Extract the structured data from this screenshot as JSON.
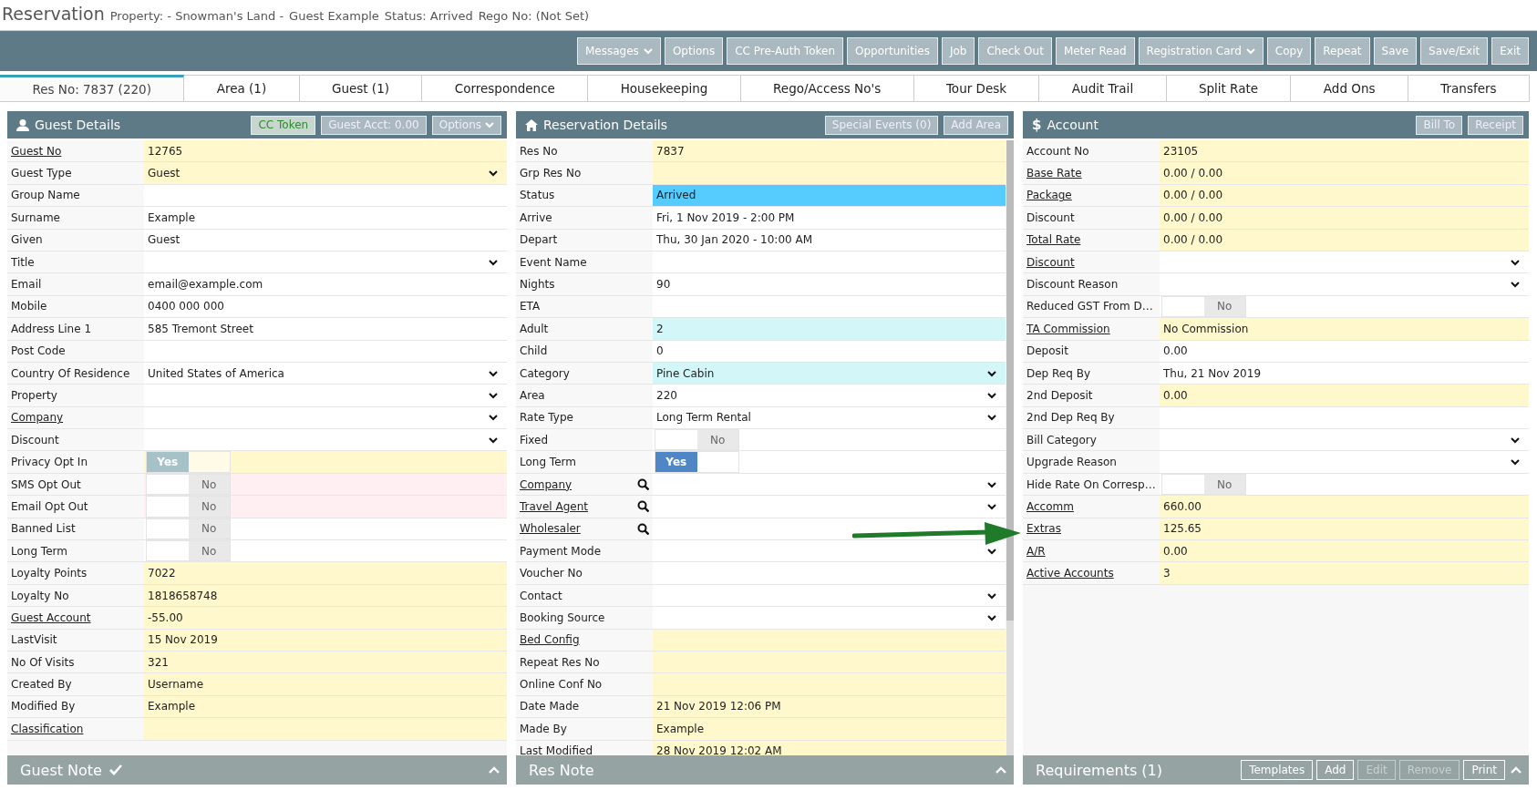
{
  "header": {
    "title": "Reservation",
    "details": [
      "Property: - Snowman's Land -",
      "Guest Example",
      "Status: Arrived",
      "Rego No: (Not Set)"
    ]
  },
  "toolbar": [
    {
      "label": "Messages",
      "dropdown": true
    },
    {
      "label": "Options",
      "dropdown": false
    },
    {
      "label": "CC Pre-Auth Token",
      "dropdown": false
    },
    {
      "label": "Opportunities",
      "dropdown": false
    },
    {
      "label": "Job",
      "dropdown": false
    },
    {
      "label": "Check Out",
      "dropdown": false
    },
    {
      "label": "Meter Read",
      "dropdown": false
    },
    {
      "label": "Registration Card",
      "dropdown": true
    },
    {
      "label": "Copy",
      "dropdown": false
    },
    {
      "label": "Repeat",
      "dropdown": false
    },
    {
      "label": "Save",
      "dropdown": false
    },
    {
      "label": "Save/Exit",
      "dropdown": false
    },
    {
      "label": "Exit",
      "dropdown": false
    }
  ],
  "tabs": [
    {
      "label": "Res No: 7837 (220)",
      "selected": true
    },
    {
      "label": "Area (1)",
      "selected": false
    },
    {
      "label": "Guest (1)",
      "selected": false
    },
    {
      "label": "Correspondence",
      "selected": false
    },
    {
      "label": "Housekeeping",
      "selected": false
    },
    {
      "label": "Rego/Access No's",
      "selected": false
    },
    {
      "label": "Tour Desk",
      "selected": false
    },
    {
      "label": "Audit Trail",
      "selected": false
    },
    {
      "label": "Split Rate",
      "selected": false
    },
    {
      "label": "Add Ons",
      "selected": false
    },
    {
      "label": "Transfers",
      "selected": false
    }
  ],
  "panels": [
    {
      "title": "Guest Details",
      "kind": "guest",
      "buttons": [
        {
          "label": "CC Token",
          "kind": "token",
          "dropdown": false
        },
        {
          "label": "Guest Acct: 0.00",
          "kind": "plain",
          "dropdown": false
        },
        {
          "label": "Options",
          "kind": "plain",
          "dropdown": true
        }
      ],
      "rows": [
        {
          "label": "Guest No",
          "link": true,
          "kind": "text",
          "value": "12765",
          "color": "#fff8cc"
        },
        {
          "label": "Guest Type",
          "link": false,
          "kind": "select",
          "value": "Guest",
          "color": "#fff8cc"
        },
        {
          "label": "Group Name",
          "link": false,
          "kind": "text"
        },
        {
          "label": "Surname",
          "link": false,
          "kind": "text",
          "value": "Example"
        },
        {
          "label": "Given",
          "link": false,
          "kind": "text",
          "value": "Guest"
        },
        {
          "label": "Title",
          "link": false,
          "kind": "select"
        },
        {
          "label": "Email",
          "link": false,
          "kind": "text",
          "value": "email@example.com"
        },
        {
          "label": "Mobile",
          "link": false,
          "kind": "text",
          "value": "0400 000 000"
        },
        {
          "label": "Address Line 1",
          "link": false,
          "kind": "text",
          "value": "585 Tremont Street"
        },
        {
          "label": "Post Code",
          "link": false,
          "kind": "text"
        },
        {
          "label": "Country Of Residence",
          "link": false,
          "kind": "select",
          "value": "United States of America"
        },
        {
          "label": "Property",
          "link": false,
          "kind": "select"
        },
        {
          "label": "Company",
          "link": true,
          "kind": "select"
        },
        {
          "label": "Discount",
          "link": false,
          "kind": "select"
        },
        {
          "label": "Privacy Opt In",
          "link": false,
          "kind": "toggle",
          "on": true,
          "disabled": true,
          "option": "Yes",
          "color": "#fff8cc"
        },
        {
          "label": "SMS Opt Out",
          "link": false,
          "kind": "toggle",
          "on": false,
          "disabled": false,
          "option": "No",
          "color": "#ffeef2"
        },
        {
          "label": "Email Opt Out",
          "link": false,
          "kind": "toggle",
          "on": false,
          "disabled": false,
          "option": "No",
          "color": "#ffeef2"
        },
        {
          "label": "Banned List",
          "link": false,
          "kind": "toggle",
          "on": false,
          "disabled": false,
          "option": "No"
        },
        {
          "label": "Long Term",
          "link": false,
          "kind": "toggle",
          "on": false,
          "disabled": false,
          "option": "No"
        },
        {
          "label": "Loyalty Points",
          "link": false,
          "kind": "text",
          "value": "7022",
          "color": "#fff8cc"
        },
        {
          "label": "Loyalty No",
          "link": false,
          "kind": "text",
          "value": "1818658748",
          "color": "#fff8cc"
        },
        {
          "label": "Guest Account",
          "link": true,
          "kind": "text",
          "value": "-55.00",
          "color": "#fff8cc"
        },
        {
          "label": "LastVisit",
          "link": false,
          "kind": "text",
          "value": "15 Nov 2019",
          "color": "#fff8cc"
        },
        {
          "label": "No Of Visits",
          "link": false,
          "kind": "text",
          "value": "321",
          "color": "#fff8cc"
        },
        {
          "label": "Created By",
          "link": false,
          "kind": "text",
          "value": "Username",
          "color": "#fff8cc"
        },
        {
          "label": "Modified By",
          "link": false,
          "kind": "text",
          "value": "Example",
          "color": "#fff8cc"
        },
        {
          "label": "Classification",
          "link": true,
          "kind": "text",
          "color": "#fff8cc"
        }
      ]
    },
    {
      "title": "Reservation Details",
      "kind": "reservation",
      "buttons": [
        {
          "label": "Special Events (0)",
          "kind": "plain",
          "dropdown": false
        },
        {
          "label": "Add Area",
          "kind": "plain",
          "dropdown": false
        }
      ],
      "rows": [
        {
          "label": "Res No",
          "link": false,
          "kind": "text",
          "value": "7837",
          "color": "#fff8cc"
        },
        {
          "label": "Grp Res No",
          "link": false,
          "kind": "text",
          "color": "#fff8cc"
        },
        {
          "label": "Status",
          "link": false,
          "kind": "text",
          "value": "Arrived",
          "color": "#55ccfd"
        },
        {
          "label": "Arrive",
          "link": false,
          "kind": "text",
          "value": "Fri, 1 Nov 2019 - 2:00 PM"
        },
        {
          "label": "Depart",
          "link": false,
          "kind": "text",
          "value": "Thu, 30 Jan 2020 - 10:00 AM"
        },
        {
          "label": "Event Name",
          "link": false,
          "kind": "text"
        },
        {
          "label": "Nights",
          "link": false,
          "kind": "text",
          "value": "90"
        },
        {
          "label": "ETA",
          "link": false,
          "kind": "text"
        },
        {
          "label": "Adult",
          "link": false,
          "kind": "text",
          "value": "2",
          "color": "#d3f6f9"
        },
        {
          "label": "Child",
          "link": false,
          "kind": "text",
          "value": "0"
        },
        {
          "label": "Category",
          "link": false,
          "kind": "select",
          "value": "Pine Cabin",
          "color": "#d3f6f9"
        },
        {
          "label": "Area",
          "link": false,
          "kind": "select",
          "value": "220"
        },
        {
          "label": "Rate Type",
          "link": false,
          "kind": "select",
          "value": "Long Term Rental"
        },
        {
          "label": "Fixed",
          "link": false,
          "kind": "toggle",
          "on": false,
          "disabled": false,
          "option": "No"
        },
        {
          "label": "Long Term",
          "link": false,
          "kind": "toggle",
          "on": true,
          "disabled": false,
          "option": "Yes"
        },
        {
          "label": "Company",
          "link": true,
          "search": true,
          "kind": "select"
        },
        {
          "label": "Travel Agent",
          "link": true,
          "search": true,
          "kind": "select"
        },
        {
          "label": "Wholesaler",
          "link": true,
          "search": true,
          "kind": "text"
        },
        {
          "label": "Payment Mode",
          "link": false,
          "kind": "select"
        },
        {
          "label": "Voucher No",
          "link": false,
          "kind": "text"
        },
        {
          "label": "Contact",
          "link": false,
          "kind": "select"
        },
        {
          "label": "Booking Source",
          "link": false,
          "kind": "select"
        },
        {
          "label": "Bed Config",
          "link": true,
          "kind": "text",
          "color": "#fff8cc"
        },
        {
          "label": "Repeat Res No",
          "link": false,
          "kind": "text",
          "color": "#fff8cc"
        },
        {
          "label": "Online Conf No",
          "link": false,
          "kind": "text",
          "color": "#fff8cc"
        },
        {
          "label": "Date Made",
          "link": false,
          "kind": "text",
          "value": "21 Nov 2019 12:06 PM",
          "color": "#fff8cc"
        },
        {
          "label": "Made By",
          "link": false,
          "kind": "text",
          "value": "Example",
          "color": "#fff8cc"
        },
        {
          "label": "Last Modified",
          "kind": "text",
          "value": "28 Nov 2019 12:02 AM",
          "color": "#fff8cc"
        }
      ]
    },
    {
      "title": "Account",
      "kind": "account",
      "glyph": "$",
      "buttons": [
        {
          "label": "Bill To",
          "kind": "plain",
          "dropdown": false
        },
        {
          "label": "Receipt",
          "kind": "plain",
          "dropdown": false
        }
      ],
      "rows": [
        {
          "label": "Account No",
          "link": false,
          "kind": "text",
          "value": "23105",
          "color": "#fff8cc"
        },
        {
          "label": "Base Rate",
          "link": true,
          "kind": "text",
          "value": "0.00 / 0.00",
          "color": "#fff8cc"
        },
        {
          "label": "Package",
          "link": true,
          "kind": "text",
          "value": "0.00 / 0.00",
          "color": "#fff8cc"
        },
        {
          "label": "Discount",
          "link": false,
          "kind": "text",
          "value": "0.00 / 0.00",
          "color": "#fff8cc"
        },
        {
          "label": "Total Rate",
          "link": true,
          "kind": "text",
          "value": "0.00 / 0.00",
          "color": "#fff8cc"
        },
        {
          "label": "Discount",
          "link": true,
          "kind": "select"
        },
        {
          "label": "Discount Reason",
          "link": false,
          "kind": "select"
        },
        {
          "label": "Reduced GST From D…",
          "link": false,
          "kind": "toggle",
          "on": false,
          "disabled": false,
          "option": "No"
        },
        {
          "label": "TA Commission",
          "link": true,
          "kind": "text",
          "value": "No Commission",
          "color": "#fff8cc"
        },
        {
          "label": "Deposit",
          "link": false,
          "kind": "text",
          "value": "0.00"
        },
        {
          "label": "Dep Req By",
          "link": false,
          "kind": "text",
          "value": "Thu, 21 Nov 2019"
        },
        {
          "label": "2nd Deposit",
          "link": false,
          "kind": "text",
          "value": "0.00",
          "color": "#fff8cc"
        },
        {
          "label": "2nd Dep Req By",
          "link": false,
          "kind": "text"
        },
        {
          "label": "Bill Category",
          "link": false,
          "kind": "select"
        },
        {
          "label": "Upgrade Reason",
          "link": false,
          "kind": "select"
        },
        {
          "label": "Hide Rate On Corresp…",
          "link": false,
          "kind": "toggle",
          "on": false,
          "disabled": false,
          "option": "No"
        },
        {
          "label": "Accomm",
          "link": true,
          "kind": "text",
          "value": "660.00",
          "color": "#fff8cc"
        },
        {
          "label": "Extras",
          "link": true,
          "kind": "text",
          "value": "125.65",
          "color": "#fff8cc"
        },
        {
          "label": "A/R",
          "link": true,
          "kind": "text",
          "value": "0.00",
          "color": "#fff8cc"
        },
        {
          "label": "Active Accounts",
          "link": true,
          "kind": "text",
          "value": "3",
          "color": "#fff8cc"
        }
      ]
    }
  ],
  "notes": [
    {
      "title": "Guest Note",
      "confirmed": true
    },
    {
      "title": "Res Note",
      "confirmed": false
    },
    {
      "title": "Requirements (1)",
      "confirmed": false,
      "buttons": [
        {
          "label": "Templates",
          "disabled": false
        },
        {
          "label": "Add",
          "disabled": false
        },
        {
          "label": "Edit",
          "disabled": true
        },
        {
          "label": "Remove",
          "disabled": true
        },
        {
          "label": "Print",
          "disabled": false
        }
      ]
    }
  ],
  "annotation": {
    "kind": "arrow"
  }
}
